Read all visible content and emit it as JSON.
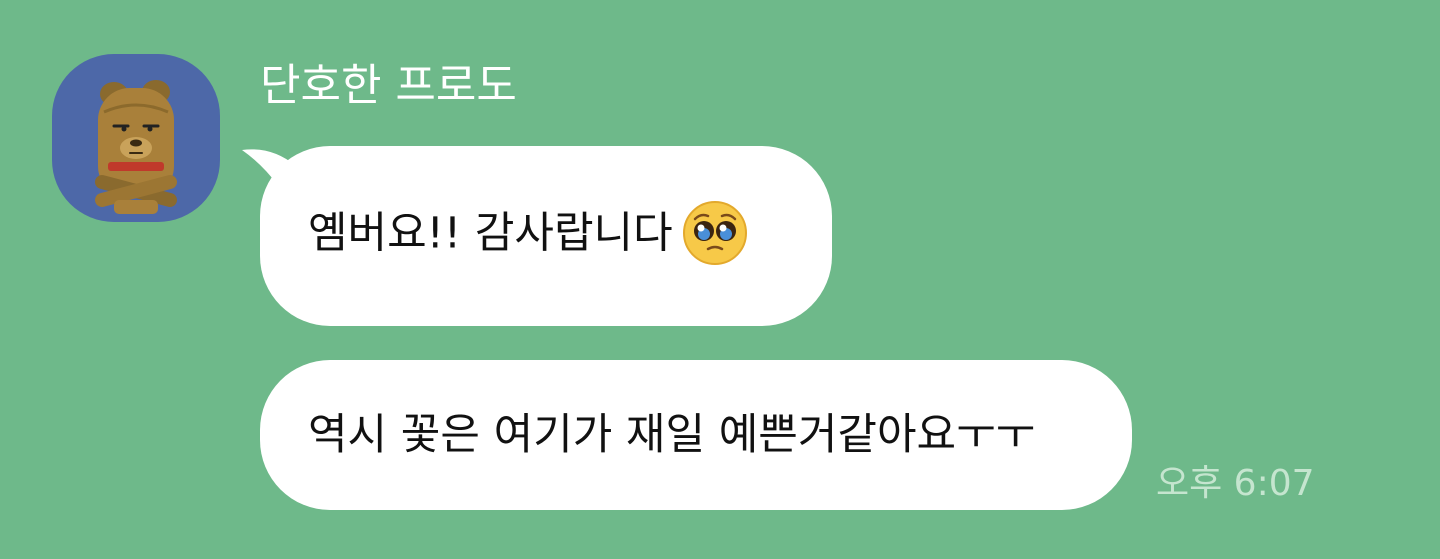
{
  "chat": {
    "sender_name": "단호한 프로도",
    "avatar_icon": "frodo-character-icon",
    "messages": [
      {
        "text": "옘버요!! 감사랍니다",
        "emoji_icon": "pleading-face-icon"
      },
      {
        "text": "역시 꽃은 여기가 재일 예쁜거같아요ㅜㅜ"
      }
    ],
    "timestamp": "오후 6:07"
  },
  "colors": {
    "background": "#6eb98a",
    "bubble": "#ffffff",
    "avatar_bg": "#4d68a8",
    "timestamp": "#c5e5cf"
  }
}
